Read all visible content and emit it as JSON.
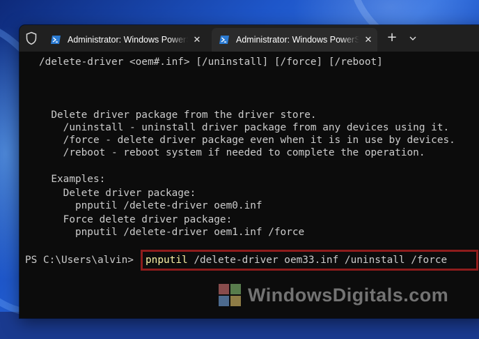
{
  "window": {
    "tabs": [
      {
        "title": "Administrator: Windows PowerShell",
        "active": false
      },
      {
        "title": "Administrator: Windows PowerShell",
        "active": true
      }
    ],
    "close_glyph": "✕",
    "new_tab_glyph": "+"
  },
  "console": {
    "lines": [
      "/delete-driver <oem#.inf> [/uninstall] [/force] [/reboot]",
      "",
      "  Delete driver package from the driver store.",
      "    /uninstall - uninstall driver package from any devices using it.",
      "    /force - delete driver package even when it is in use by devices.",
      "    /reboot - reboot system if needed to complete the operation.",
      "",
      "  Examples:",
      "    Delete driver package:",
      "      pnputil /delete-driver oem0.inf",
      "    Force delete driver package:",
      "      pnputil /delete-driver oem1.inf /force"
    ],
    "prompt": "PS C:\\Users\\alvin>",
    "command_name": "pnputil",
    "command_args": " /delete-driver oem33.inf /uninstall /force"
  },
  "watermark": {
    "text": "WindowsDigitals.com"
  },
  "colors": {
    "terminal_bg": "#0c0c0c",
    "tabbar_bg": "#202020",
    "active_tab_bg": "#2b2b2b",
    "text": "#cccccc",
    "command_highlight": "#f9f1a5",
    "highlight_box": "#8e1c1c"
  }
}
